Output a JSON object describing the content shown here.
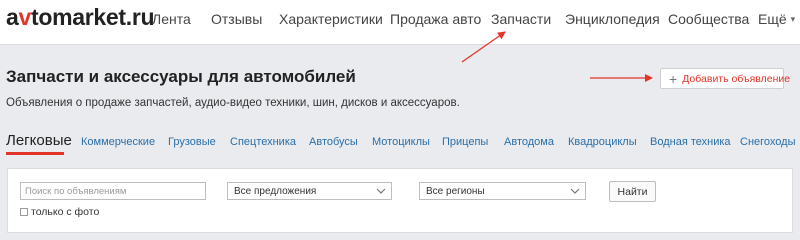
{
  "logo": {
    "prefix": "a",
    "v": "v",
    "rest": "tomarket.ru"
  },
  "nav": {
    "items": [
      "Лента",
      "Отзывы",
      "Характеристики",
      "Продажа авто",
      "Запчасти",
      "Энциклопедия",
      "Сообщества",
      "Ещё"
    ]
  },
  "page": {
    "title": "Запчасти и аксессуары для автомобилей",
    "description": "Объявления о продаже запчастей, аудио-видео техники, шин, дисков и аксессуаров.",
    "add_button": "Добавить объявление"
  },
  "tabs": {
    "active": "Легковые",
    "items": [
      "Коммерческие",
      "Грузовые",
      "Спецтехника",
      "Автобусы",
      "Мотоциклы",
      "Прицепы",
      "Автодома",
      "Квадроциклы",
      "Водная техника",
      "Снегоходы"
    ]
  },
  "filters": {
    "search_placeholder": "Поиск по объявлениям",
    "offers_select": "Все предложения",
    "regions_select": "Все регионы",
    "find_button": "Найти",
    "photo_only": "только с фото"
  },
  "colors": {
    "accent": "#e3342a",
    "link": "#2a6fa8",
    "background": "#e9ebee"
  },
  "icons": {
    "add": "plus-icon",
    "dropdown": "chevron-down-icon",
    "more": "caret-down-icon"
  }
}
